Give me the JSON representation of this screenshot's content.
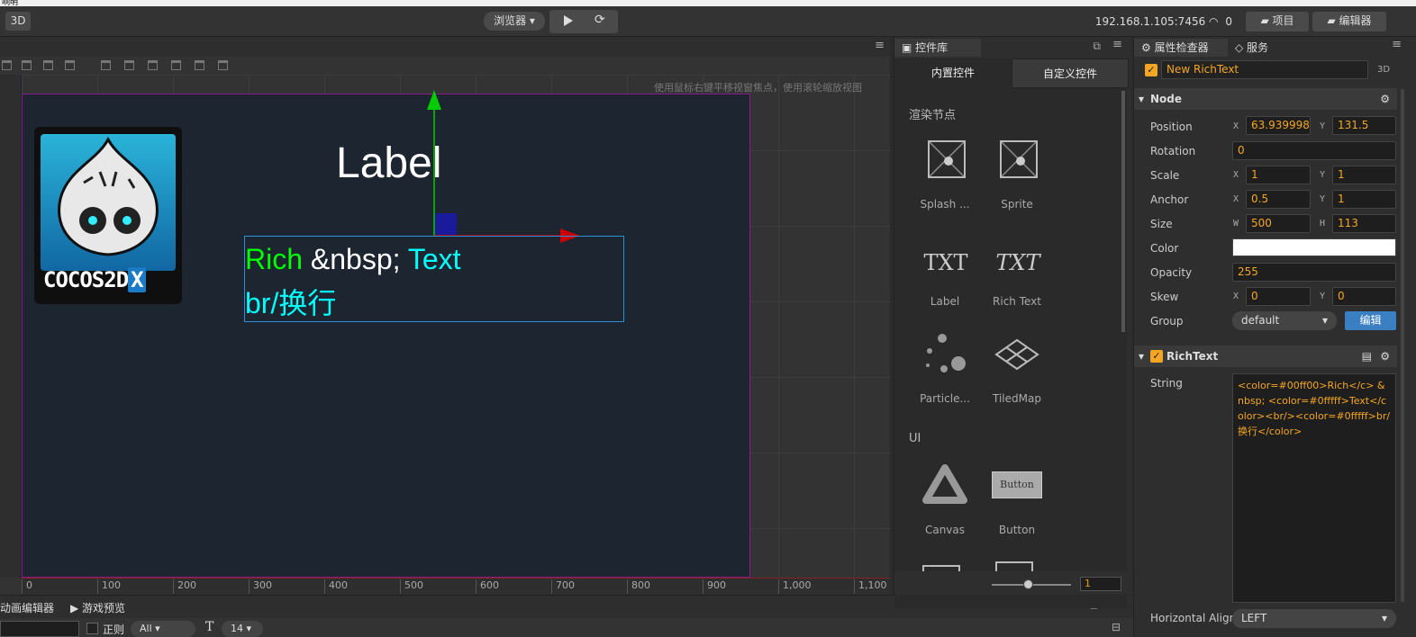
{
  "top_strip": {
    "text": "响明"
  },
  "toolbar": {
    "mode_3d": "3D",
    "browser_select": "浏览器 ▾",
    "ip": "192.168.1.105:7456",
    "wifi_count": "0",
    "project_button": "项目",
    "editor_button": "编辑器"
  },
  "scene": {
    "hint": "使用鼠标右键平移视窗焦点，使用滚轮缩放视图",
    "logo_text": "COCOS2D",
    "logo_x": "X",
    "label_text": "Label",
    "rich_text": {
      "rich": "Rich",
      "nbsp": " &nbsp; ",
      "text": "Text",
      "line2": "br/换行"
    },
    "ruler_x": [
      "0",
      "100",
      "200",
      "300",
      "400",
      "500",
      "600",
      "700",
      "800",
      "900",
      "1,000",
      "1,100"
    ]
  },
  "bottom": {
    "tab_anim": "动画编辑器",
    "tab_preview": "游戏预览",
    "regex_label": "正则",
    "filter_value": "All",
    "size_value": "14"
  },
  "library": {
    "tab": "控件库",
    "subtab_builtin": "内置控件",
    "subtab_custom": "自定义控件",
    "section_render": "渲染节点",
    "section_ui": "UI",
    "items": [
      {
        "label": "Splash ...",
        "icon": "splash-icon"
      },
      {
        "label": "Sprite",
        "icon": "sprite-icon"
      },
      {
        "label": "Label",
        "icon": "label-icon",
        "glyph": "TXT"
      },
      {
        "label": "Rich Text",
        "icon": "richtext-icon",
        "glyph": "TXT"
      },
      {
        "label": "Particle...",
        "icon": "particle-icon"
      },
      {
        "label": "TiledMap",
        "icon": "tiledmap-icon"
      },
      {
        "label": "Canvas",
        "icon": "canvas-icon"
      },
      {
        "label": "Button",
        "icon": "button-icon",
        "glyph": "Button"
      }
    ],
    "zoom_value": "1"
  },
  "inspector": {
    "tab_inspector": "属性检查器",
    "tab_service": "服务",
    "node_name": "New RichText",
    "badge_3d": "3D",
    "node_section": "Node",
    "position": {
      "label": "Position",
      "x": "63.939998",
      "y": "131.5"
    },
    "rotation": {
      "label": "Rotation",
      "value": "0"
    },
    "scale": {
      "label": "Scale",
      "x": "1",
      "y": "1"
    },
    "anchor": {
      "label": "Anchor",
      "x": "0.5",
      "y": "1"
    },
    "size": {
      "label": "Size",
      "w": "500",
      "h": "113"
    },
    "color": {
      "label": "Color",
      "value": "#ffffff"
    },
    "opacity": {
      "label": "Opacity",
      "value": "255"
    },
    "skew": {
      "label": "Skew",
      "x": "0",
      "y": "0"
    },
    "group": {
      "label": "Group",
      "value": "default",
      "edit": "编辑"
    },
    "richtext_section": "RichText",
    "string": {
      "label": "String",
      "value": "<color=#00ff00>Rich</c> &nbsp; <color=#0fffff>Text</color><br/><color=#0fffff>br/换行</color>"
    },
    "halign": {
      "label": "Horizontal Align",
      "value": "LEFT"
    },
    "axis_x": "X",
    "axis_y": "Y",
    "axis_w": "W",
    "axis_h": "H"
  }
}
